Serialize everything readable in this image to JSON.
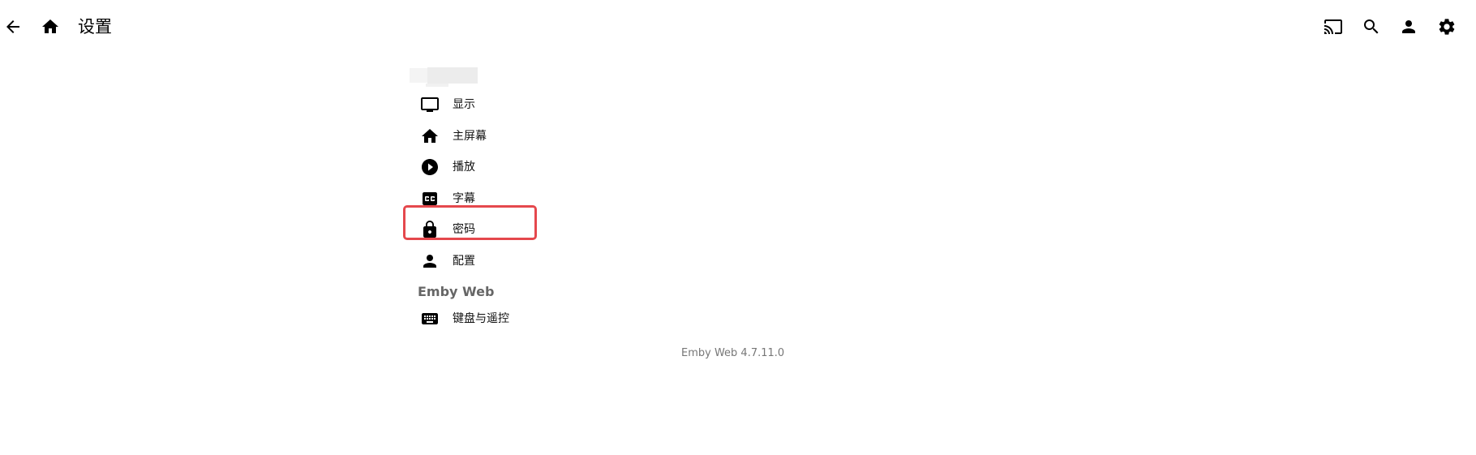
{
  "header": {
    "title": "设置",
    "left_icons": [
      "back-arrow-icon",
      "home-icon"
    ],
    "right_icons": [
      "cast-icon",
      "search-icon",
      "user-icon",
      "settings-icon"
    ]
  },
  "settings": {
    "items": [
      {
        "label": "显示",
        "icon": "display-icon"
      },
      {
        "label": "主屏幕",
        "icon": "home-icon"
      },
      {
        "label": "播放",
        "icon": "play-icon"
      },
      {
        "label": "字幕",
        "icon": "closed-captions-icon"
      },
      {
        "label": "密码",
        "icon": "lock-icon",
        "highlighted": true
      },
      {
        "label": "配置",
        "icon": "person-icon"
      }
    ],
    "section_title": "Emby Web",
    "section_items": [
      {
        "label": "键盘与遥控",
        "icon": "keyboard-icon"
      }
    ]
  },
  "footer": {
    "version": "Emby Web 4.7.11.0"
  },
  "colors": {
    "highlight_border": "#e5484d",
    "section_title": "#666666",
    "version_text": "#777777"
  }
}
